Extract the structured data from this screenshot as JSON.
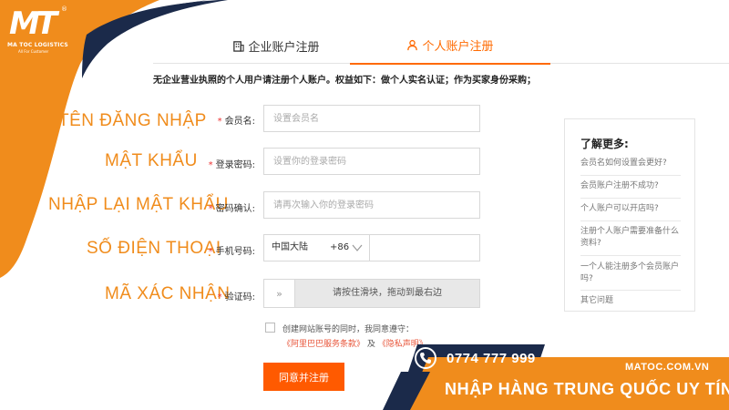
{
  "brand": {
    "logo_mark": "MT",
    "logo_registered": "®",
    "name": "MA TOC LOGISTICS",
    "tagline": "All For Customer"
  },
  "colors": {
    "accent": "#ff6a00",
    "annotation": "#f08c1c",
    "navy": "#1b2a4a",
    "banner_orange": "#f08c1c"
  },
  "tabs": [
    {
      "label": "企业账户注册",
      "icon": "building-icon",
      "active": false
    },
    {
      "label": "个人账户注册",
      "icon": "user-icon",
      "active": true
    }
  ],
  "notice": "无企业营业执照的个人用户请注册个人账户。权益如下：做个人实名认证；作为买家身份采购；",
  "annotations": {
    "username": "TÊN ĐĂNG NHẬP",
    "password": "MẬT KHẨU",
    "confirm": "NHẬP LẠI MẬT KHẨU",
    "phone": "SỐ ĐIỆN THOẠI",
    "captcha": "MÃ XÁC NHẬN"
  },
  "form": {
    "required_mark": "*",
    "username_label": "会员名:",
    "username_placeholder": "设置会员名",
    "password_label": "登录密码:",
    "password_placeholder": "设置你的登录密码",
    "confirm_label": "密码确认:",
    "confirm_placeholder": "请再次输入你的登录密码",
    "phone_label": "手机号码:",
    "phone_country": "中国大陆",
    "phone_code": "+86",
    "captcha_label": "验证码:",
    "slider_handle": "»",
    "slider_text": "请按住滑块，拖动到最右边",
    "agree_text": "创建网站账号的同时，我同意遵守：",
    "agree_link1": "《阿里巴巴服务条款》",
    "agree_and": "及",
    "agree_link2": "《隐私声明》",
    "submit_label": "同意并注册"
  },
  "help": {
    "title": "了解更多:",
    "links": [
      "会员名如何设置会更好?",
      "会员账户注册不成功?",
      "个人账户可以开店吗?",
      "注册个人账户需要准备什么资料?",
      "一个人能注册多个会员账户吗?",
      "其它问题"
    ]
  },
  "banner": {
    "phone": "0774 777 999",
    "website": "MATOC.COM.VN",
    "slogan": "NHẬP HÀNG TRUNG QUỐC UY TÍN"
  }
}
